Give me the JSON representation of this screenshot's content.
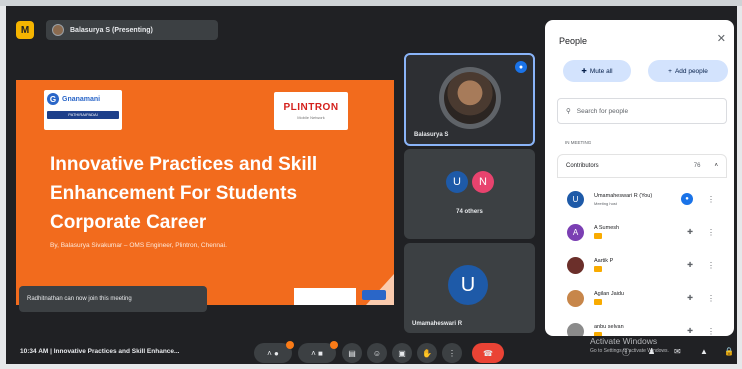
{
  "top": {
    "presenting_label": "Balasurya S (Presenting)",
    "app_badge": "M"
  },
  "slide": {
    "logo_left_name": "Gnanamani",
    "logo_left_bar": "PATHIRAIPADAI",
    "logo_right_name": "PLINTRON",
    "logo_right_sub": "Mobile Network",
    "title": "Innovative Practices and Skill Enhancement For Students Corporate Career",
    "byline": "By, Balasurya Sivakumar – OMS Engineer, Plintron, Chennai."
  },
  "toast": "Radhitnathan can now join this meeting",
  "tiles": {
    "speaker_name": "Balasurya S",
    "others_label": "74 others",
    "others_initials": [
      "U",
      "N"
    ],
    "others_colors": [
      "#1e5aa8",
      "#e8436e"
    ],
    "bottom_name": "Umamaheswari R",
    "bottom_initial": "U"
  },
  "people": {
    "title": "People",
    "mute_all": "Mute all",
    "add_people": "Add people",
    "search_placeholder": "Search for people",
    "section_label": "IN MEETING",
    "contributors_label": "Contributors",
    "contributors_count": "76",
    "rows": [
      {
        "name": "Umamaheswari R (You)",
        "sub": "Meeting host",
        "initial": "U",
        "color": "#1e5aa8",
        "mic": "on",
        "hand": false
      },
      {
        "name": "A Sumesh",
        "sub": "",
        "initial": "A",
        "color": "#7b3fb3",
        "mic": "off",
        "hand": true
      },
      {
        "name": "Aartik P",
        "sub": "",
        "initial": "",
        "color": "#6b2f2a",
        "mic": "off",
        "hand": true
      },
      {
        "name": "Agilan Jaidu",
        "sub": "",
        "initial": "",
        "color": "#c7864a",
        "mic": "off",
        "hand": true
      },
      {
        "name": "anbu selvan",
        "sub": "",
        "initial": "",
        "color": "#8b8b8b",
        "mic": "off",
        "hand": true
      }
    ]
  },
  "bottom": {
    "clock_meeting": "10:34 AM  |  Innovative Practices and Skill Enhance...",
    "watermark_title": "Activate Windows",
    "watermark_sub": "Go to Settings to activate Windows."
  },
  "colors": {
    "accent": "#1a73e8",
    "slide_orange": "#f26b1d",
    "end_call": "#ea4335",
    "raised_hand": "#f9ab00"
  }
}
